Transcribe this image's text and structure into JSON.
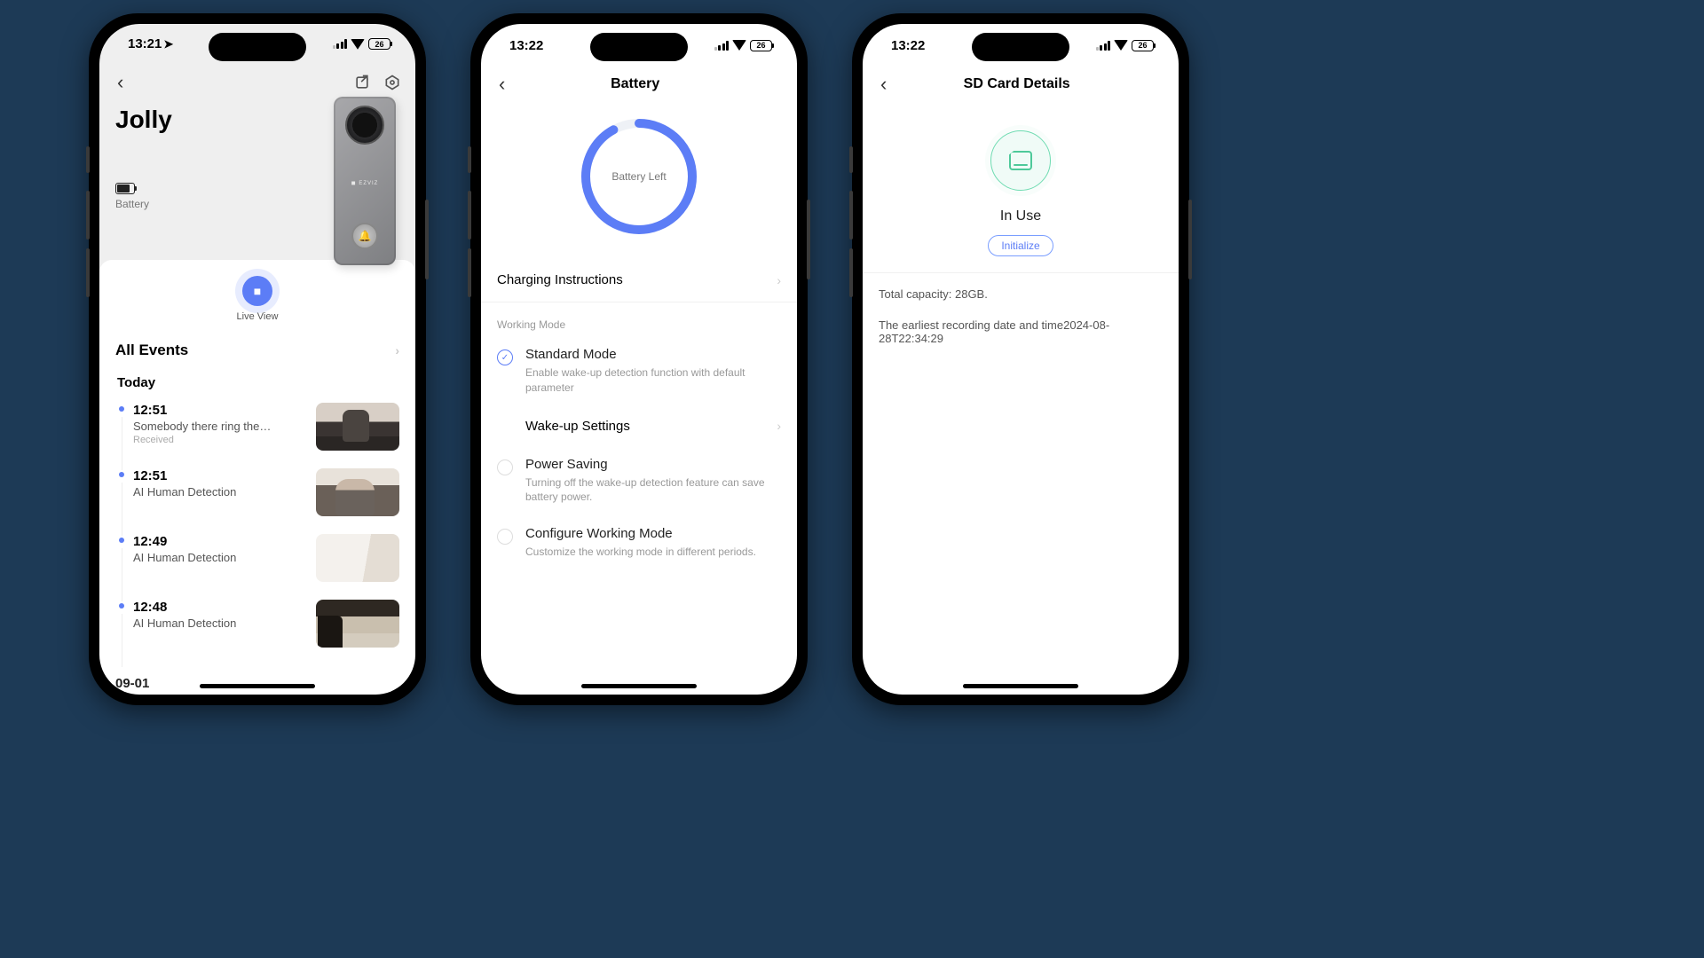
{
  "status": {
    "battery_pct": "26"
  },
  "phone1": {
    "time": "13:21",
    "device_name": "Jolly",
    "battery_label": "Battery",
    "live_view": "Live View",
    "all_events": "All Events",
    "today": "Today",
    "events": [
      {
        "time": "12:51",
        "desc": "Somebody there ring the…",
        "sub": "Received"
      },
      {
        "time": "12:51",
        "desc": "AI Human Detection",
        "sub": ""
      },
      {
        "time": "12:49",
        "desc": "AI Human Detection",
        "sub": ""
      },
      {
        "time": "12:48",
        "desc": "AI Human Detection",
        "sub": ""
      }
    ],
    "date_footer": "09-01"
  },
  "phone2": {
    "time": "13:22",
    "title": "Battery",
    "ring_label": "Battery Left",
    "battery_fraction": 0.92,
    "charging_row": "Charging Instructions",
    "working_mode_label": "Working Mode",
    "modes": {
      "standard_t": "Standard Mode",
      "standard_d": "Enable wake-up detection function with default parameter",
      "wakeup": "Wake-up Settings",
      "power_t": "Power Saving",
      "power_d": "Turning off the wake-up detection feature can save battery power.",
      "config_t": "Configure Working Mode",
      "config_d": "Customize the working mode in different periods."
    }
  },
  "phone3": {
    "time": "13:22",
    "title": "SD Card Details",
    "status": "In Use",
    "init_btn": "Initialize",
    "capacity": "Total capacity: 28GB.",
    "earliest": "The earliest recording date and time2024-08-28T22:34:29"
  }
}
